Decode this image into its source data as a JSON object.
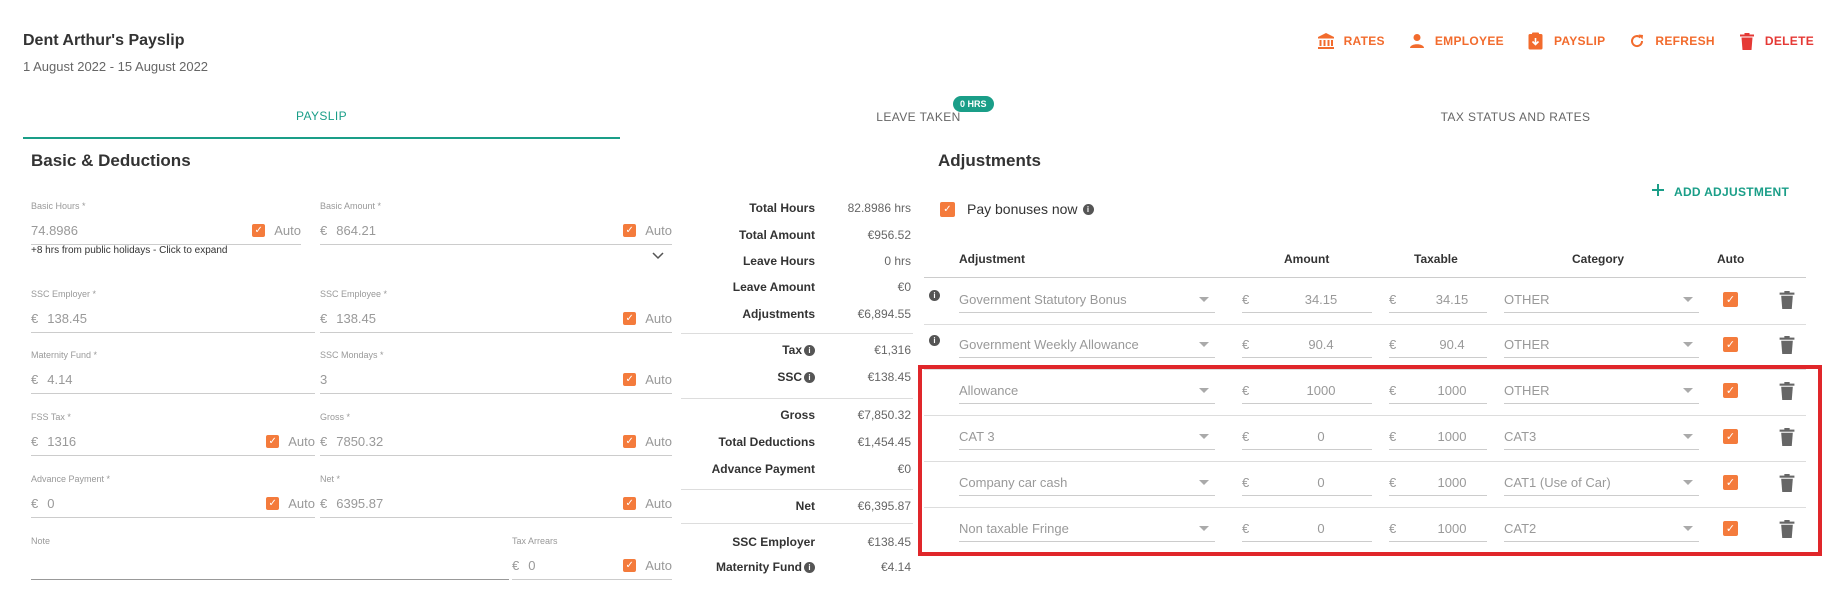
{
  "header": {
    "title": "Dent Arthur's Payslip",
    "period": "1 August 2022 - 15 August 2022",
    "actions": [
      {
        "label": "RATES",
        "icon": "bank-icon"
      },
      {
        "label": "EMPLOYEE",
        "icon": "person-icon"
      },
      {
        "label": "PAYSLIP",
        "icon": "download-doc-icon"
      },
      {
        "label": "REFRESH",
        "icon": "refresh-icon"
      },
      {
        "label": "DELETE",
        "icon": "trash-icon"
      }
    ]
  },
  "tabs": {
    "payslip": "PAYSLIP",
    "leave": "LEAVE TAKEN",
    "leave_badge": "0 HRS",
    "tax": "TAX STATUS AND RATES"
  },
  "basic": {
    "title": "Basic & Deductions",
    "auto_label": "Auto",
    "currency": "€",
    "basic_hours": {
      "label": "Basic Hours *",
      "value": "74.8986"
    },
    "basic_amount": {
      "label": "Basic Amount *",
      "value": "864.21"
    },
    "hint": "+8 hrs from public holidays - Click to expand",
    "ssc_employer": {
      "label": "SSC Employer *",
      "value": "138.45"
    },
    "ssc_employee": {
      "label": "SSC Employee *",
      "value": "138.45"
    },
    "maternity_fund": {
      "label": "Maternity Fund *",
      "value": "4.14"
    },
    "ssc_mondays": {
      "label": "SSC Mondays *",
      "value": "3"
    },
    "fss_tax": {
      "label": "FSS Tax *",
      "value": "1316"
    },
    "gross": {
      "label": "Gross *",
      "value": "7850.32"
    },
    "advance_payment": {
      "label": "Advance Payment *",
      "value": "0"
    },
    "net": {
      "label": "Net *",
      "value": "6395.87"
    },
    "note": {
      "label": "Note",
      "value": ""
    },
    "tax_arrears": {
      "label": "Tax Arrears",
      "value": "0"
    }
  },
  "summary": [
    {
      "k": "Total Hours",
      "v": "82.8986 hrs"
    },
    {
      "k": "Total Amount",
      "v": "€956.52"
    },
    {
      "k": "Leave Hours",
      "v": "0 hrs"
    },
    {
      "k": "Leave Amount",
      "v": "€0"
    },
    {
      "k": "Adjustments",
      "v": "€6,894.55"
    },
    {
      "k": "Tax",
      "v": "€1,316"
    },
    {
      "k": "SSC",
      "v": "€138.45"
    },
    {
      "k": "Gross",
      "v": "€7,850.32"
    },
    {
      "k": "Total Deductions",
      "v": "€1,454.45"
    },
    {
      "k": "Advance Payment",
      "v": "€0"
    },
    {
      "k": "Net",
      "v": "€6,395.87"
    },
    {
      "k": "SSC Employer",
      "v": "€138.45"
    },
    {
      "k": "Maternity Fund",
      "v": "€4.14"
    }
  ],
  "adjustments": {
    "title": "Adjustments",
    "add_label": "ADD ADJUSTMENT",
    "pay_bonuses_label": "Pay bonuses now",
    "columns": {
      "adjustment": "Adjustment",
      "amount": "Amount",
      "taxable": "Taxable",
      "category": "Category",
      "auto": "Auto"
    },
    "currency": "€",
    "rows": [
      {
        "name": "Government Statutory Bonus",
        "amount": "34.15",
        "taxable": "34.15",
        "category": "OTHER",
        "info": true
      },
      {
        "name": "Government Weekly Allowance",
        "amount": "90.4",
        "taxable": "90.4",
        "category": "OTHER",
        "info": true
      },
      {
        "name": "Allowance",
        "amount": "1000",
        "taxable": "1000",
        "category": "OTHER",
        "info": false
      },
      {
        "name": "CAT 3",
        "amount": "0",
        "taxable": "1000",
        "category": "CAT3",
        "info": false
      },
      {
        "name": "Company car cash",
        "amount": "0",
        "taxable": "1000",
        "category": "CAT1 (Use of Car)",
        "info": false
      },
      {
        "name": "Non taxable Fringe",
        "amount": "0",
        "taxable": "1000",
        "category": "CAT2",
        "info": false
      }
    ]
  },
  "colors": {
    "accent": "#f26b2d",
    "teal": "#1a9e88",
    "danger": "#e53935",
    "highlight": "#e0262a"
  }
}
